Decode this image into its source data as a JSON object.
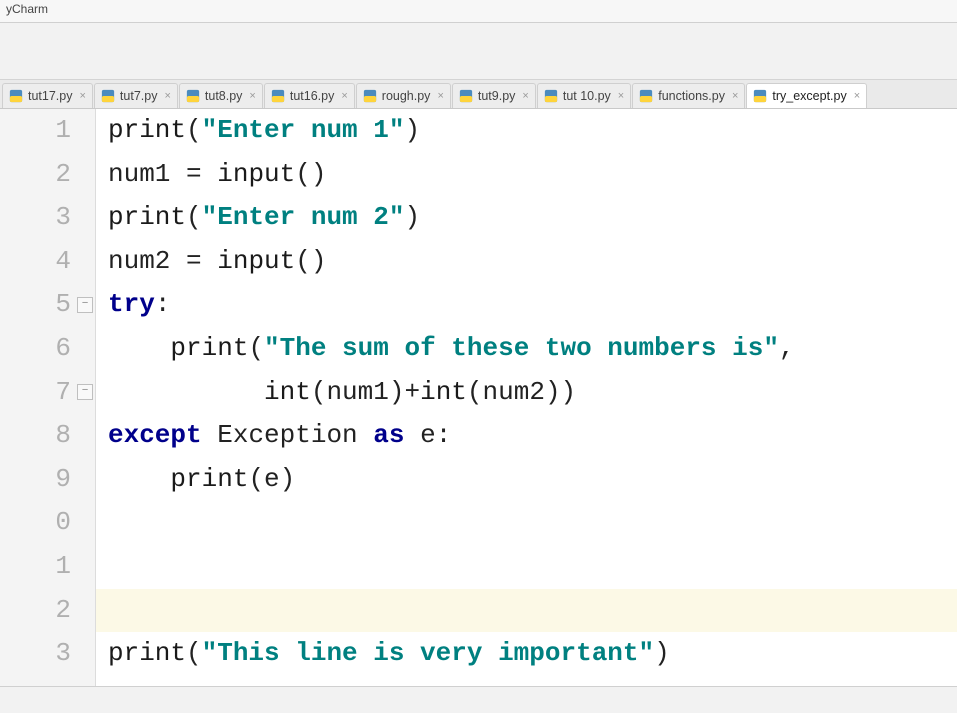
{
  "app": {
    "title": "yCharm"
  },
  "tabs": [
    {
      "label": "tut17.py",
      "active": false
    },
    {
      "label": "tut7.py",
      "active": false
    },
    {
      "label": "tut8.py",
      "active": false
    },
    {
      "label": "tut16.py",
      "active": false
    },
    {
      "label": "rough.py",
      "active": false
    },
    {
      "label": "tut9.py",
      "active": false
    },
    {
      "label": "tut 10.py",
      "active": false
    },
    {
      "label": "functions.py",
      "active": false
    },
    {
      "label": "try_except.py",
      "active": true
    }
  ],
  "line_numbers": [
    "1",
    "2",
    "3",
    "4",
    "5",
    "6",
    "7",
    "8",
    "9",
    "0",
    "1",
    "2",
    "3"
  ],
  "folds": {
    "5": true,
    "7": true
  },
  "highlight_line": 12,
  "code": {
    "l1": {
      "fn": "print",
      "op": "(",
      "str": "\"Enter num 1\"",
      "cp": ")"
    },
    "l2": {
      "id": "num1",
      "eq": " = ",
      "fn": "input",
      "op": "(",
      "cp": ")"
    },
    "l3": {
      "fn": "print",
      "op": "(",
      "str": "\"Enter num 2\"",
      "cp": ")"
    },
    "l4": {
      "id": "num2",
      "eq": " = ",
      "fn": "input",
      "op": "(",
      "cp": ")"
    },
    "l5": {
      "kw": "try",
      "colon": ":"
    },
    "l6": {
      "indent": "    ",
      "fn": "print",
      "op": "(",
      "str": "\"The sum of these two numbers is\"",
      "comma": ","
    },
    "l7": {
      "indent": "          ",
      "fn": "int",
      "op1": "(",
      "id1": "num1",
      "cp1": ")",
      "plus": "+",
      "fn2": "int",
      "op2": "(",
      "id2": "num2",
      "cp2": ")",
      "cp3": ")"
    },
    "l8": {
      "kw1": "except",
      "sp": " ",
      "cls": "Exception",
      "sp2": " ",
      "kw2": "as",
      "sp3": " ",
      "id": "e",
      "colon": ":"
    },
    "l9": {
      "indent": "    ",
      "fn": "print",
      "op": "(",
      "id": "e",
      "cp": ")"
    },
    "l10": {
      "blank": ""
    },
    "l11": {
      "blank": ""
    },
    "l12": {
      "blank": ""
    },
    "l13": {
      "fn": "print",
      "op": "(",
      "str": "\"This line is very important\"",
      "cp": ")"
    }
  }
}
